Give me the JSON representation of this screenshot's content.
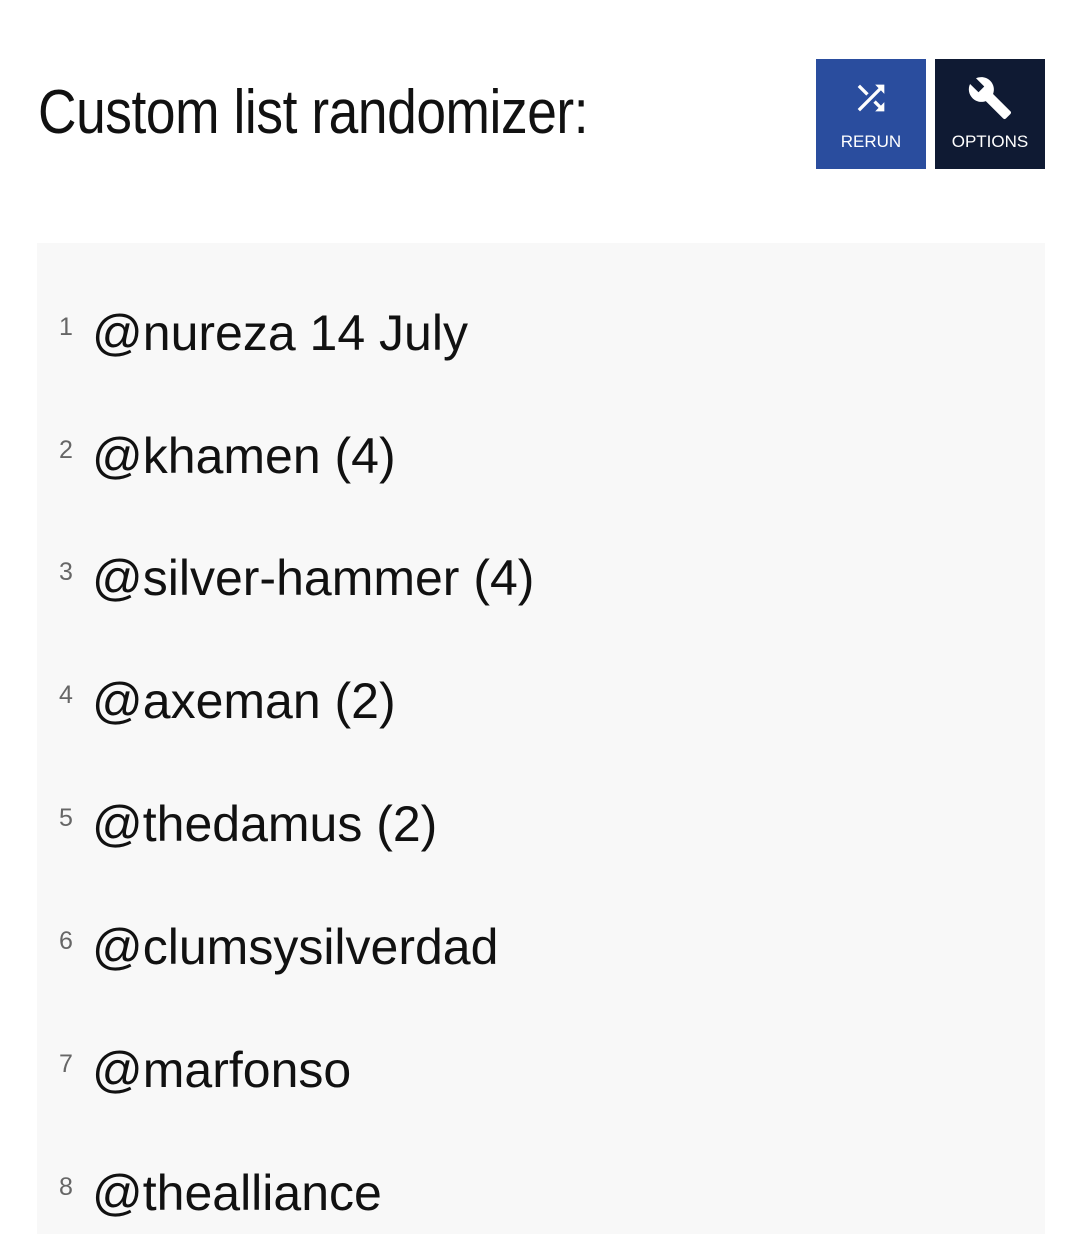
{
  "header": {
    "title": "Custom list randomizer:"
  },
  "toolbar": {
    "rerun": {
      "label": "RERUN",
      "icon": "shuffle-icon",
      "color": "#2a4d9e"
    },
    "options": {
      "label": "OPTIONS",
      "icon": "wrench-icon",
      "color": "#0f1a33"
    }
  },
  "results": {
    "items": [
      {
        "number": "1",
        "text": "@nureza 14 July"
      },
      {
        "number": "2",
        "text": "@khamen (4)"
      },
      {
        "number": "3",
        "text": "@silver-hammer (4)"
      },
      {
        "number": "4",
        "text": "@axeman (2)"
      },
      {
        "number": "5",
        "text": "@thedamus (2)"
      },
      {
        "number": "6",
        "text": "@clumsysilverdad"
      },
      {
        "number": "7",
        "text": "@marfonso"
      },
      {
        "number": "8",
        "text": "@thealliance"
      }
    ]
  }
}
